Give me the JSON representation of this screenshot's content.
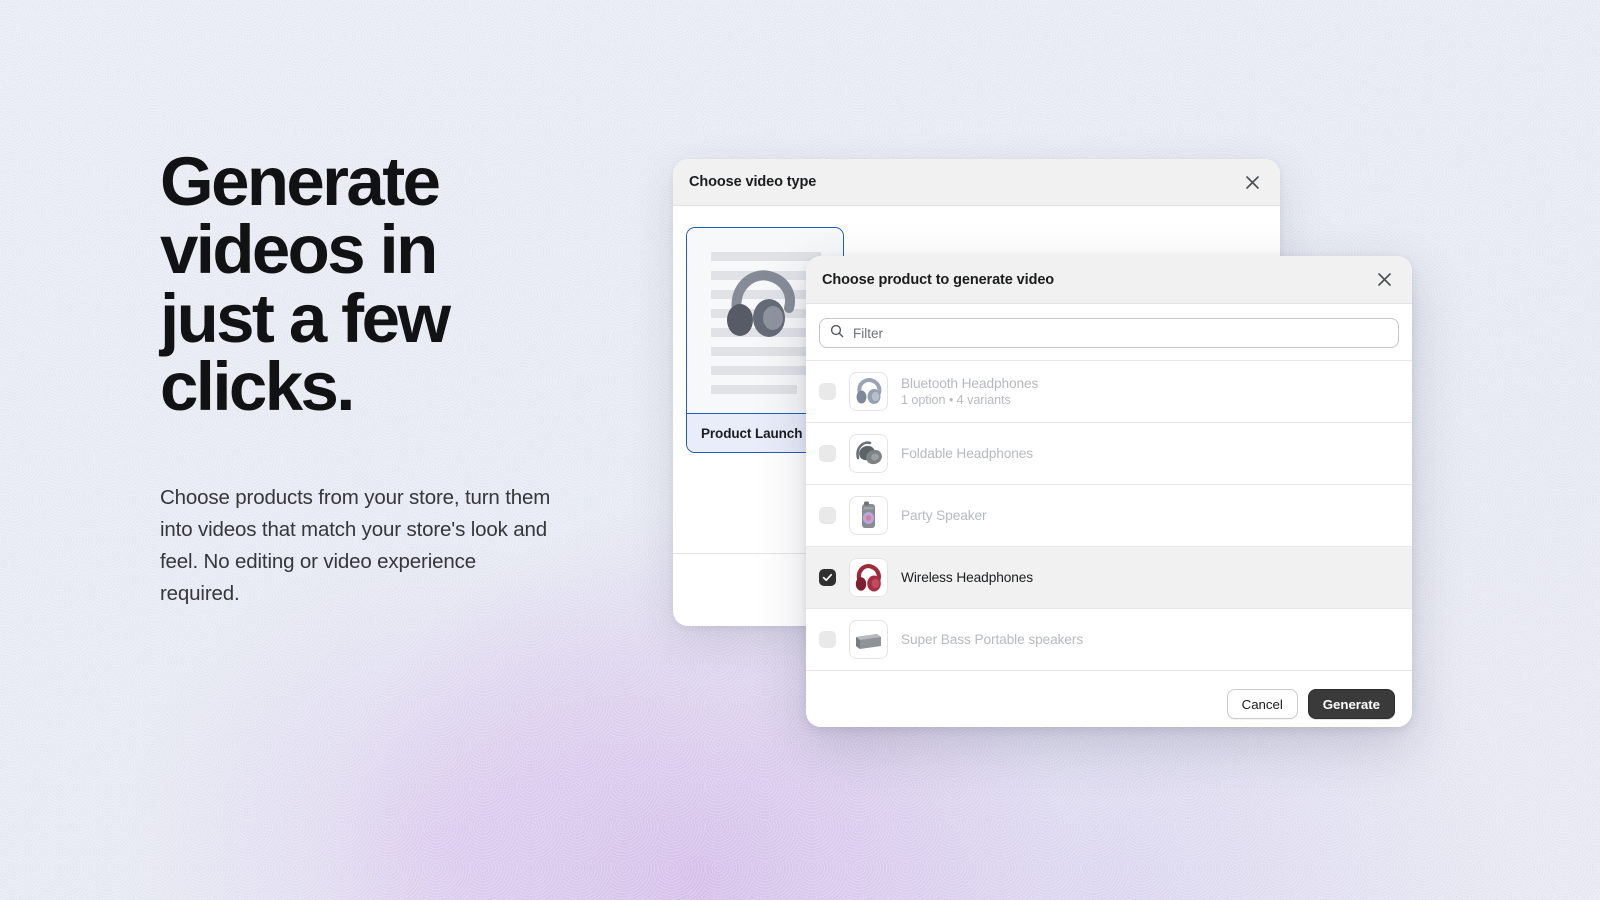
{
  "hero": {
    "title": "Generate videos in just a few clicks.",
    "subtitle": "Choose products from your store, turn them into videos that match your store's look and feel. No editing or video experience required."
  },
  "video_type_modal": {
    "title": "Choose video type",
    "close_label": "×",
    "cards": [
      {
        "label": "Product Launch",
        "selected": true
      }
    ]
  },
  "product_modal": {
    "title": "Choose product to generate video",
    "close_label": "×",
    "search": {
      "placeholder": "Filter",
      "value": "",
      "icon": "search-icon"
    },
    "products": [
      {
        "name": "Bluetooth Headphones",
        "meta": "1 option • 4 variants",
        "checked": false,
        "thumbnail": "bluetooth-headphones-thumbnail"
      },
      {
        "name": "Foldable Headphones",
        "meta": "",
        "checked": false,
        "thumbnail": "foldable-headphones-thumbnail"
      },
      {
        "name": "Party Speaker",
        "meta": "",
        "checked": false,
        "thumbnail": "party-speaker-thumbnail"
      },
      {
        "name": "Wireless Headphones",
        "meta": "",
        "checked": true,
        "thumbnail": "wireless-headphones-thumbnail"
      },
      {
        "name": "Super Bass Portable speakers",
        "meta": "",
        "checked": false,
        "thumbnail": "super-bass-speakers-thumbnail"
      }
    ],
    "footer": {
      "cancel_label": "Cancel",
      "generate_label": "Generate"
    }
  },
  "colors": {
    "background": "#e7eaf2",
    "accent_purple": "#d0b0e8",
    "selected_border": "#1f5eb8",
    "selected_card_label_bg": "#e9edfa",
    "primary_button": "#3a3a3a",
    "checked_checkbox": "#303030"
  }
}
